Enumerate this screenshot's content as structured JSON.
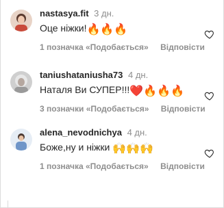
{
  "comments": [
    {
      "username": "nastasya.fit",
      "time": "3 дн.",
      "text": "Оце ніжки!",
      "emoji": "🔥🔥🔥",
      "likes": "1 позначка «Подобається»",
      "reply": "Відповісти",
      "avatar_bg": "#c94a3a"
    },
    {
      "username": "taniushataniusha73",
      "time": "4 дн.",
      "text": "Наталя Ви СУПЕР!!!",
      "emoji": "❤️🔥🔥🔥",
      "likes": "3 позначки «Подобається»",
      "reply": "Відповісти",
      "avatar_bg": "#9a9a9a"
    },
    {
      "username": "alena_nevodnichya",
      "time": "4 дн.",
      "text": "Боже,ну и ніжки",
      "emoji": "🙌🙌🙌",
      "likes": "1 позначка «Подобається»",
      "reply": "Відповісти",
      "avatar_bg": "#6f95c8"
    }
  ],
  "icons": {
    "like": "heart-outline-icon"
  },
  "colors": {
    "text": "#262626",
    "meta": "#8e8e8e",
    "border": "#dbdbdb"
  }
}
